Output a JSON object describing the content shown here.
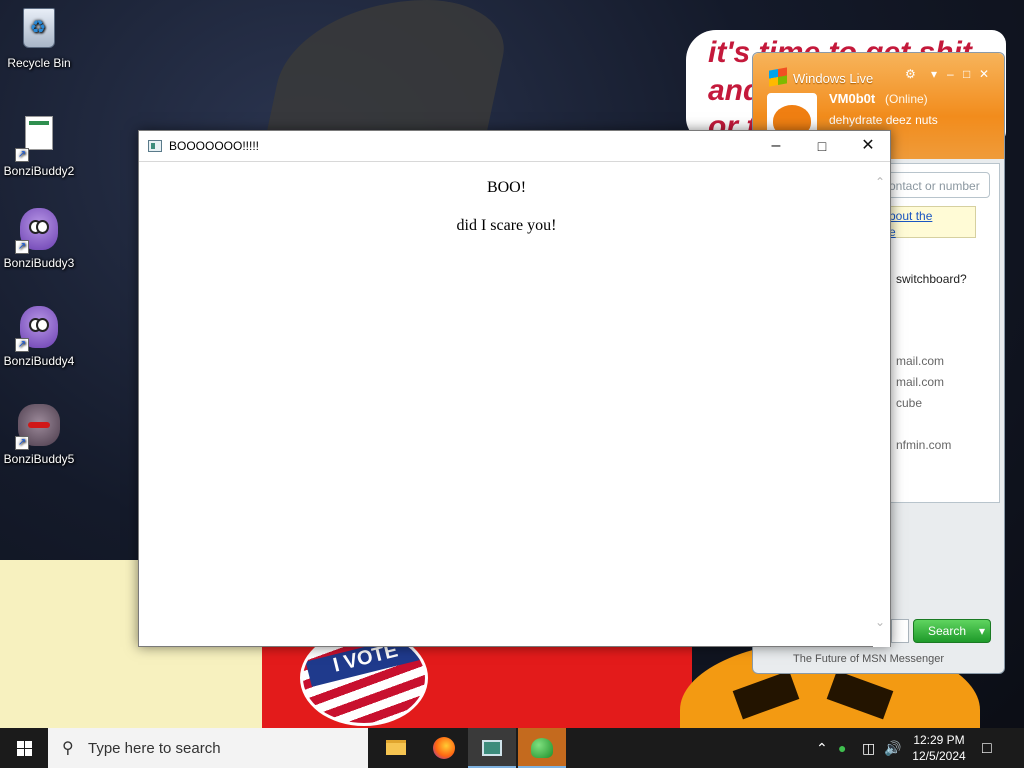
{
  "desktop": {
    "icons": [
      {
        "label": "Recycle Bin",
        "icon": "recycle-bin-icon"
      },
      {
        "label": "BonziBuddy2",
        "icon": "document-shortcut-icon"
      },
      {
        "label": "BonziBuddy3",
        "icon": "bonzi-purple-icon"
      },
      {
        "label": "BonziBuddy4",
        "icon": "bonzi-purple-icon"
      },
      {
        "label": "BonziBuddy5",
        "icon": "monkey-icon"
      }
    ],
    "wallpaper_text": [
      "it's time to get shit",
      "and",
      "or t"
    ],
    "badge_text": "I VOTE"
  },
  "messenger": {
    "brand": "Windows Live",
    "display_name": "VM0b0t",
    "status": "(Online)",
    "personal_message": "dehydrate deez nuts",
    "search_placeholder": "contact or number",
    "note_lines": [
      "bout the",
      "e"
    ],
    "question": "switchboard?",
    "contacts": [
      "mail.com",
      "mail.com",
      "cube",
      "nfmin.com"
    ],
    "search_button": "Search",
    "footer": "The Future of MSN Messenger"
  },
  "popup": {
    "title": "BOOOOOOO!!!!!",
    "heading": "BOO!",
    "message": "did I scare you!"
  },
  "taskbar": {
    "search_placeholder": "Type here to search",
    "time": "12:29 PM",
    "date": "12/5/2024"
  }
}
